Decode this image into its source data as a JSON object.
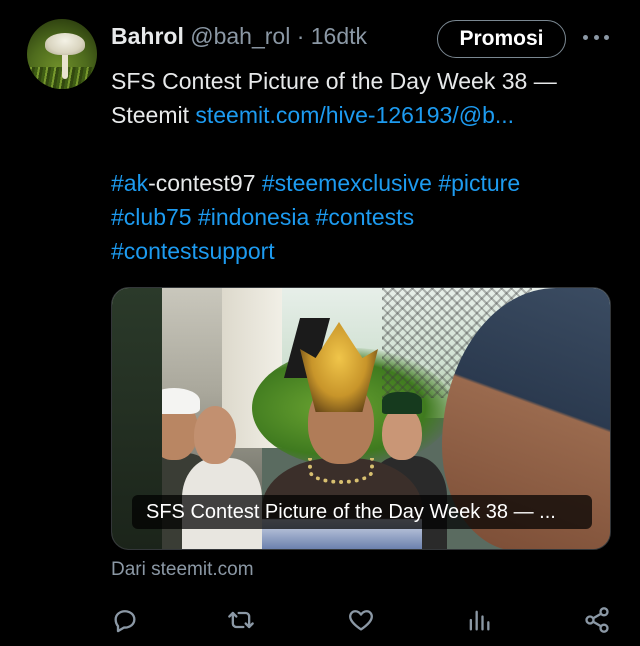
{
  "tweet": {
    "author_name": "Bahrol",
    "author_handle": "@bah_rol",
    "separator": "·",
    "time": "16dtk",
    "promo_label": "Promosi",
    "text_line1": "SFS Contest Picture of the Day Week 38 —",
    "text_line2_prefix": "Steemit ",
    "text_link": "steemit.com/hive-126193/@b...",
    "hashtags_line1": {
      "tag1_hash": "#ak",
      "tag1_rest": "-contest97",
      "tag2": "#steemexclusive",
      "tag3": "#picture"
    },
    "hashtags_line2": [
      "#club75",
      "#indonesia",
      "#contests"
    ],
    "hashtags_line3": [
      "#contestsupport"
    ],
    "card_caption": "SFS Contest Picture of the Day Week 38 — ...",
    "source_text": "Dari steemit.com"
  },
  "actions": [
    {
      "name": "reply-icon"
    },
    {
      "name": "retweet-icon"
    },
    {
      "name": "like-icon"
    },
    {
      "name": "analytics-icon"
    },
    {
      "name": "share-icon"
    }
  ],
  "colors": {
    "background": "#000000",
    "text": "#e7e9ea",
    "muted": "#8b98a5",
    "link": "#1d9bf0"
  }
}
